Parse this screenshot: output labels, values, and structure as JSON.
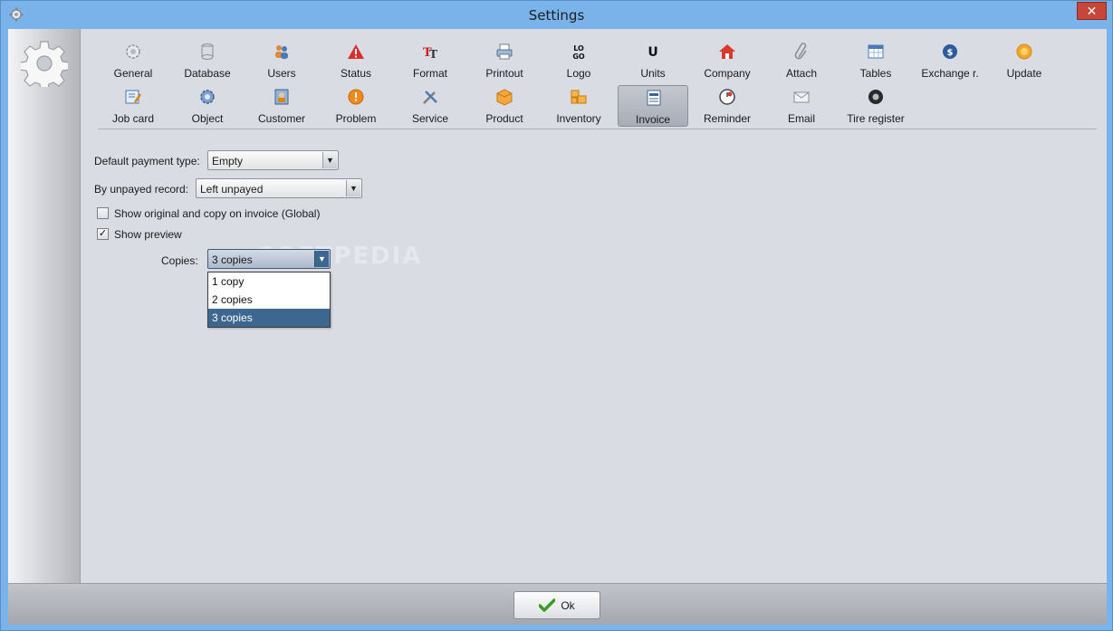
{
  "window": {
    "title": "Settings",
    "close_label": "✕"
  },
  "toolbar": {
    "row1": [
      {
        "label": "General",
        "icon": "gear-icon"
      },
      {
        "label": "Database",
        "icon": "database-icon"
      },
      {
        "label": "Users",
        "icon": "users-icon"
      },
      {
        "label": "Status",
        "icon": "warning-icon"
      },
      {
        "label": "Format",
        "icon": "format-icon"
      },
      {
        "label": "Printout",
        "icon": "printer-icon"
      },
      {
        "label": "Logo",
        "icon": "logo-icon",
        "glyph": "LO\nGO"
      },
      {
        "label": "Units",
        "icon": "units-icon",
        "glyph": "U"
      },
      {
        "label": "Company",
        "icon": "house-icon"
      },
      {
        "label": "Attach",
        "icon": "paperclip-icon"
      },
      {
        "label": "Tables",
        "icon": "table-icon"
      },
      {
        "label": "Exchange r.",
        "icon": "exchange-icon"
      },
      {
        "label": "Update",
        "icon": "update-icon"
      }
    ],
    "row2": [
      {
        "label": "Job card",
        "icon": "job-card-icon"
      },
      {
        "label": "Object",
        "icon": "object-gear-icon"
      },
      {
        "label": "Customer",
        "icon": "customer-icon"
      },
      {
        "label": "Problem",
        "icon": "problem-icon"
      },
      {
        "label": "Service",
        "icon": "tools-icon"
      },
      {
        "label": "Product",
        "icon": "box-icon"
      },
      {
        "label": "Inventory",
        "icon": "boxes-icon"
      },
      {
        "label": "Invoice",
        "icon": "invoice-icon"
      },
      {
        "label": "Reminder",
        "icon": "reminder-icon"
      },
      {
        "label": "Email",
        "icon": "envelope-icon"
      },
      {
        "label": "Tire register",
        "icon": "tire-icon"
      }
    ],
    "selected": "Invoice"
  },
  "form": {
    "default_payment_label": "Default payment type:",
    "default_payment_value": "Empty",
    "unpayed_label": "By unpayed record:",
    "unpayed_value": "Left unpayed",
    "show_original_label": "Show original and copy on invoice (Global)",
    "show_original_checked": false,
    "show_preview_label": "Show preview",
    "show_preview_checked": true,
    "copies_label": "Copies:",
    "copies_value": "3 copies",
    "copies_options": [
      "1 copy",
      "2 copies",
      "3 copies"
    ],
    "copies_selected_index": 2
  },
  "watermark": "SOFTPEDIA",
  "footer": {
    "ok_label": "Ok"
  },
  "colors": {
    "accent": "#3e6790",
    "title_bar": "#79b3ea"
  }
}
